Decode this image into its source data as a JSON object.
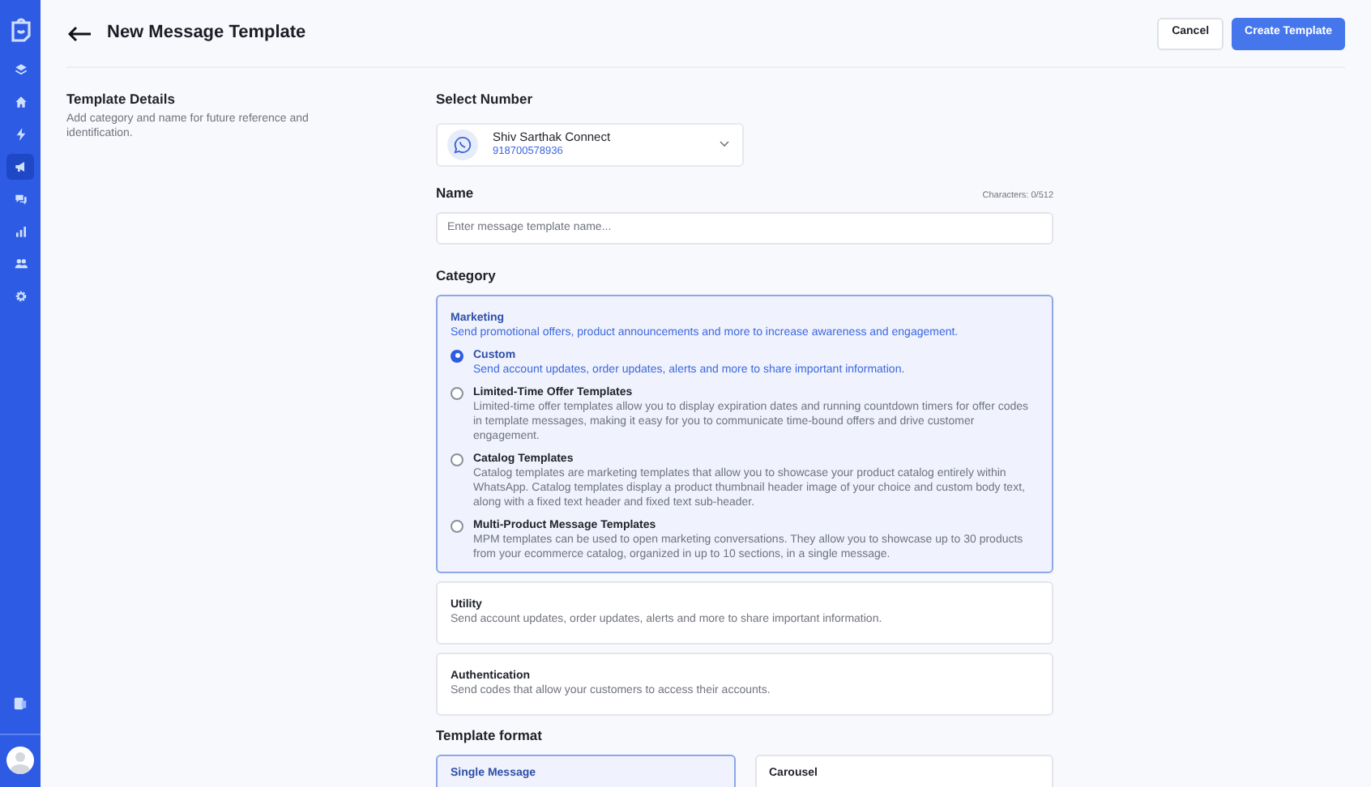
{
  "sidebar": {
    "items": [
      {
        "selected": false
      },
      {
        "selected": false
      },
      {
        "selected": false
      },
      {
        "selected": true
      },
      {
        "selected": false
      },
      {
        "selected": false
      },
      {
        "selected": false
      },
      {
        "selected": false
      }
    ]
  },
  "header": {
    "title": "New Message Template",
    "buttons": [
      {
        "label": "Cancel",
        "kind": "secondary"
      },
      {
        "label": "Create Template",
        "kind": "primary"
      }
    ]
  },
  "details": {
    "title": "Template Details",
    "description": "Add category and name for future reference and identification."
  },
  "select_number": {
    "label": "Select Number",
    "name": "Shiv Sarthak Connect",
    "number": "918700578936"
  },
  "name_field": {
    "label": "Name",
    "counter": "Characters: 0/512",
    "placeholder": "Enter message template name..."
  },
  "category": {
    "label": "Category",
    "options": [
      {
        "title": "Marketing",
        "description": "Send promotional offers, product announcements and more to increase awareness and engagement.",
        "selected": true,
        "sub_options": [
          {
            "title": "Custom",
            "description": "Send account updates, order updates, alerts and more to share important information.",
            "checked": true
          },
          {
            "title": "Limited-Time Offer Templates",
            "description": "Limited-time offer templates allow you to display expiration dates and running countdown timers for offer codes in template messages, making it easy for you to communicate time-bound offers and drive customer engagement.",
            "checked": false
          },
          {
            "title": "Catalog Templates",
            "description": "Catalog templates are marketing templates that allow you to showcase your product catalog entirely within WhatsApp. Catalog templates display a product thumbnail header image of your choice and custom body text, along with a fixed text header and fixed text sub-header.",
            "checked": false
          },
          {
            "title": "Multi-Product Message Templates",
            "description": "MPM templates can be used to open marketing conversations. They allow you to showcase up to 30 products from your ecommerce catalog, organized in up to 10 sections, in a single message.",
            "checked": false
          }
        ]
      },
      {
        "title": "Utility",
        "description": "Send account updates, order updates, alerts and more to share important information.",
        "selected": false
      },
      {
        "title": "Authentication",
        "description": "Send codes that allow your customers to access their accounts.",
        "selected": false
      }
    ]
  },
  "template_format": {
    "label": "Template format",
    "options": [
      {
        "title": "Single Message",
        "selected": true
      },
      {
        "title": "Carousel",
        "selected": false
      }
    ]
  }
}
